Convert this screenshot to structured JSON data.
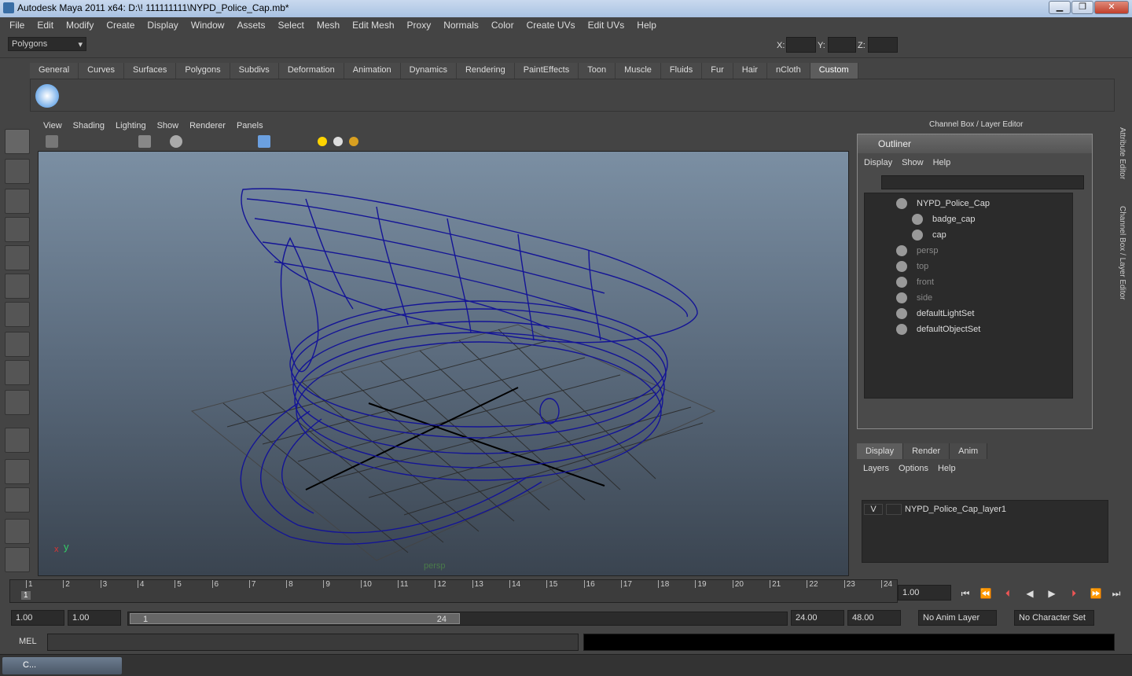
{
  "window": {
    "title": "Autodesk Maya 2011 x64: D:\\! 111111111\\NYPD_Police_Cap.mb*",
    "min": "▁",
    "max": "❐",
    "close": "✕"
  },
  "menubar": [
    "File",
    "Edit",
    "Modify",
    "Create",
    "Display",
    "Window",
    "Assets",
    "Select",
    "Mesh",
    "Edit Mesh",
    "Proxy",
    "Normals",
    "Color",
    "Create UVs",
    "Edit UVs",
    "Help"
  ],
  "status": {
    "menuset": "Polygons",
    "x_label": "X:",
    "y_label": "Y:",
    "z_label": "Z:"
  },
  "shelf": {
    "tabs": [
      "General",
      "Curves",
      "Surfaces",
      "Polygons",
      "Subdivs",
      "Deformation",
      "Animation",
      "Dynamics",
      "Rendering",
      "PaintEffects",
      "Toon",
      "Muscle",
      "Fluids",
      "Fur",
      "Hair",
      "nCloth",
      "Custom"
    ],
    "active": "Custom"
  },
  "viewport": {
    "menu": [
      "View",
      "Shading",
      "Lighting",
      "Show",
      "Renderer",
      "Panels"
    ],
    "camera": "persp",
    "axis_y": "y",
    "axis_x": "x"
  },
  "right": {
    "title": "Channel Box / Layer Editor",
    "vtab1": "Attribute Editor",
    "vtab2": "Channel Box / Layer Editor"
  },
  "outliner": {
    "title": "Outliner",
    "menu": [
      "Display",
      "Show",
      "Help"
    ],
    "items": [
      {
        "label": "NYPD_Police_Cap",
        "dim": false,
        "indent": 0
      },
      {
        "label": "badge_cap",
        "dim": false,
        "indent": 1
      },
      {
        "label": "cap",
        "dim": false,
        "indent": 1
      },
      {
        "label": "persp",
        "dim": true,
        "indent": 0
      },
      {
        "label": "top",
        "dim": true,
        "indent": 0
      },
      {
        "label": "front",
        "dim": true,
        "indent": 0
      },
      {
        "label": "side",
        "dim": true,
        "indent": 0
      },
      {
        "label": "defaultLightSet",
        "dim": false,
        "indent": 0
      },
      {
        "label": "defaultObjectSet",
        "dim": false,
        "indent": 0
      }
    ]
  },
  "layers": {
    "tabs": [
      "Display",
      "Render",
      "Anim"
    ],
    "menu": [
      "Layers",
      "Options",
      "Help"
    ],
    "v": "V",
    "layer": "NYPD_Police_Cap_layer1"
  },
  "timeline": {
    "ticks": [
      "1",
      "2",
      "3",
      "4",
      "5",
      "6",
      "7",
      "8",
      "9",
      "10",
      "11",
      "12",
      "13",
      "14",
      "15",
      "16",
      "17",
      "18",
      "19",
      "20",
      "21",
      "22",
      "23",
      "24"
    ],
    "current": "1",
    "current_field": "1.00"
  },
  "range": {
    "start": "1.00",
    "start2": "1.00",
    "slider_start": "1",
    "slider_end": "24",
    "end": "24.00",
    "end2": "48.00",
    "anim_layer": "No Anim Layer",
    "char_set": "No Character Set"
  },
  "mel": {
    "label": "MEL"
  },
  "taskbar": {
    "item": "C..."
  }
}
